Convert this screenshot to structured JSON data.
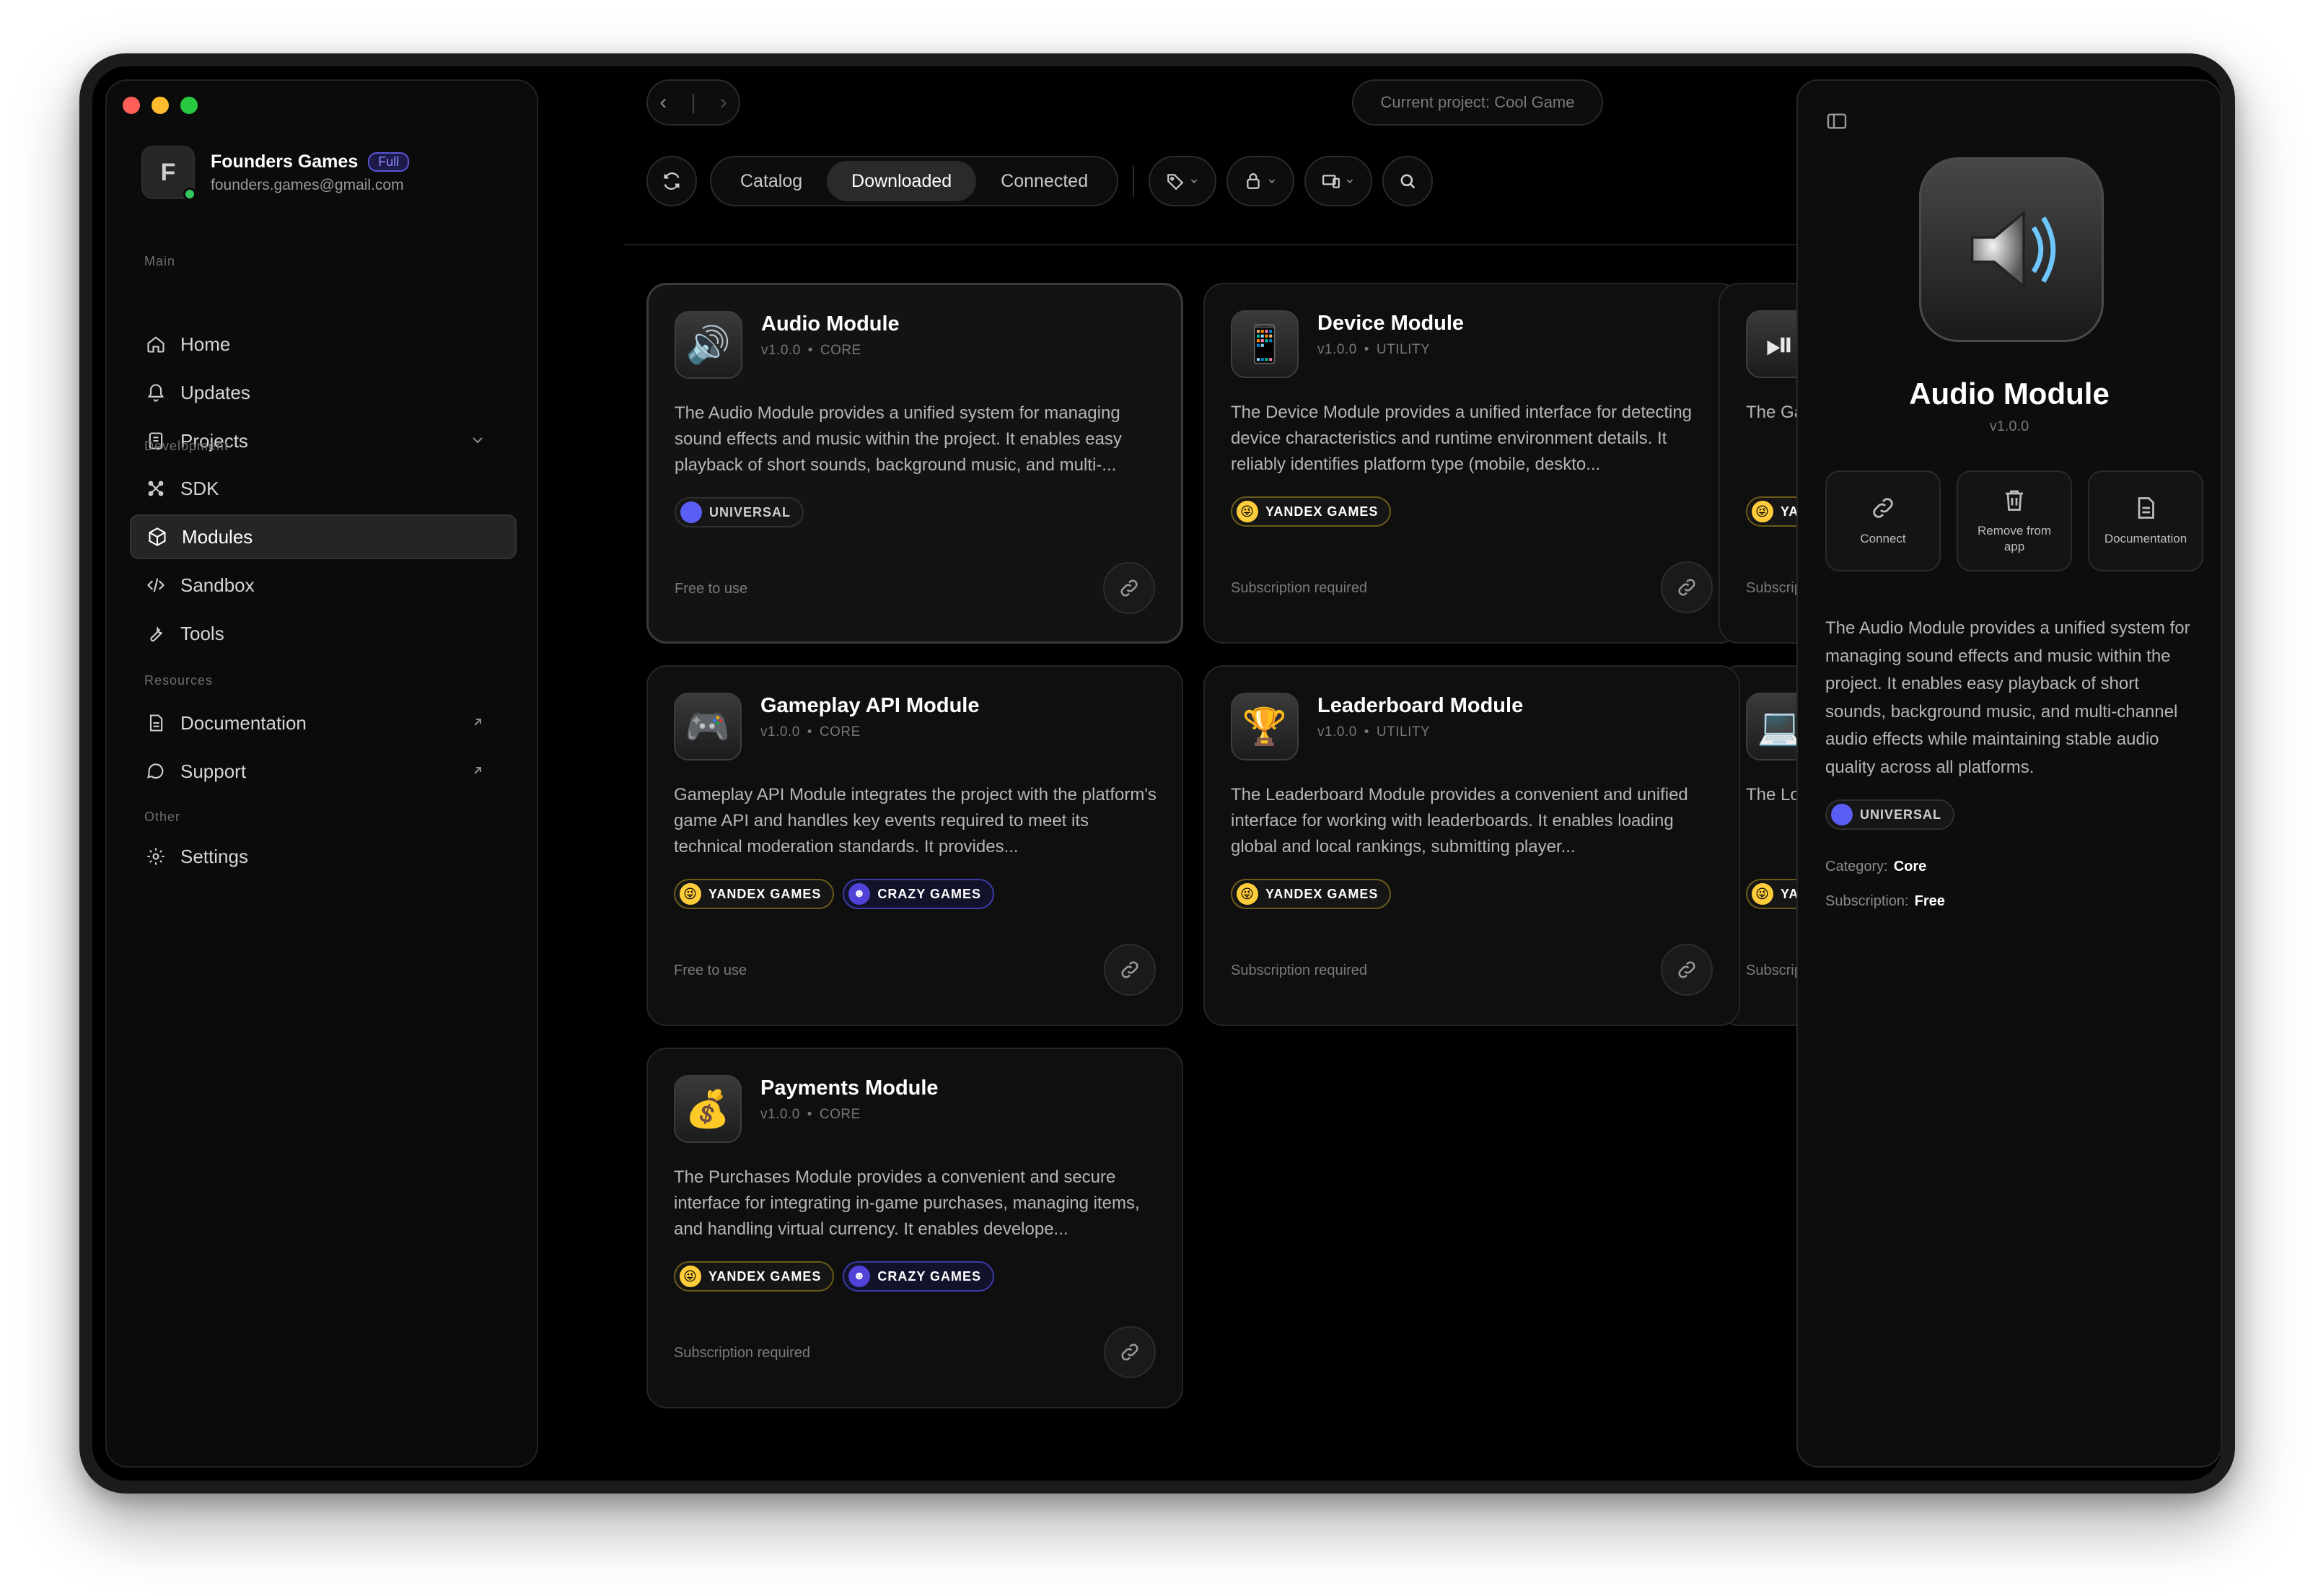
{
  "account": {
    "initial": "F",
    "name": "Founders Games",
    "plan": "Full",
    "email": "founders.games@gmail.com"
  },
  "sidebar": {
    "sections": {
      "main": "Main",
      "development": "Development",
      "resources": "Resources",
      "other": "Other"
    },
    "items": {
      "home": "Home",
      "updates": "Updates",
      "projects": "Projects",
      "sdk": "SDK",
      "modules": "Modules",
      "sandbox": "Sandbox",
      "tools": "Tools",
      "documentation": "Documentation",
      "support": "Support",
      "settings": "Settings"
    },
    "active": "modules"
  },
  "topbar": {
    "back": "‹",
    "forward": "›",
    "current_project": "Current project: Cool Game"
  },
  "tabs": [
    "Catalog",
    "Downloaded",
    "Connected"
  ],
  "active_tab": "Downloaded",
  "cards": [
    {
      "title": "Audio Module",
      "version": "v1.0.0",
      "category": "CORE",
      "icon": "speaker-icon",
      "description": "The Audio Module provides a unified system for managing sound effects and music within the project. It enables easy playback of short sounds, background music, and multi-...",
      "badges": [
        {
          "type": "universal",
          "label": "UNIVERSAL"
        }
      ],
      "footer": "Free to use"
    },
    {
      "title": "Device Module",
      "version": "v1.0.0",
      "category": "UTILITY",
      "icon": "phone-icon",
      "description": "The Device Module provides a unified interface for detecting device characteristics and runtime environment details. It reliably identifies platform type (mobile, deskto...",
      "badges": [
        {
          "type": "yandex",
          "label": "YANDEX GAMES"
        }
      ],
      "footer": "Subscription required"
    },
    {
      "title": "",
      "version": "",
      "category": "",
      "icon": "play-pause-icon",
      "description": "The Game... events trig... listens for...",
      "badges": [
        {
          "type": "yandex",
          "label": "YANDE"
        }
      ],
      "footer": "Subscription"
    },
    {
      "title": "Gameplay API Module",
      "version": "v1.0.0",
      "category": "CORE",
      "icon": "gamepad-icon",
      "description": "Gameplay API Module integrates the project with the platform's game API and handles key events required to meet its technical moderation standards. It provides...",
      "badges": [
        {
          "type": "yandex",
          "label": "YANDEX GAMES"
        },
        {
          "type": "crazy",
          "label": "CRAZY GAMES"
        }
      ],
      "footer": "Free to use"
    },
    {
      "title": "Leaderboard Module",
      "version": "v1.0.0",
      "category": "UTILITY",
      "icon": "trophy-icon",
      "description": "The Leaderboard Module provides a convenient and unified interface for working with leaderboards. It enables loading global and local rankings, submitting player...",
      "badges": [
        {
          "type": "yandex",
          "label": "YANDEX GAMES"
        }
      ],
      "footer": "Subscription required"
    },
    {
      "title": "",
      "version": "",
      "category": "",
      "icon": "laptop-icon",
      "description": "The Local... server tha... test integr...",
      "badges": [
        {
          "type": "yandex",
          "label": "YANDE"
        }
      ],
      "footer": "Subscription"
    },
    {
      "title": "Payments Module",
      "version": "v1.0.0",
      "category": "CORE",
      "icon": "money-bag-icon",
      "description": "The Purchases Module provides a convenient and secure interface for integrating in-game purchases, managing items, and handling virtual currency. It enables develope...",
      "badges": [
        {
          "type": "yandex",
          "label": "YANDEX GAMES"
        },
        {
          "type": "crazy",
          "label": "CRAZY GAMES"
        }
      ],
      "footer": "Subscription required"
    }
  ],
  "detail": {
    "title": "Audio Module",
    "version": "v1.0.0",
    "actions": {
      "connect": "Connect",
      "remove": "Remove from app",
      "documentation": "Documentation"
    },
    "description": "The Audio Module provides a unified system for managing sound effects and music within the project. It enables easy playback of short sounds, background music, and multi-channel audio effects while maintaining stable audio quality across all platforms.",
    "badge": "UNIVERSAL",
    "category_label": "Category:",
    "category": "Core",
    "subscription_label": "Subscription:",
    "subscription": "Free"
  },
  "colors": {
    "accent": "#5b5ef5",
    "yandex": "#ffcc3a",
    "crazy": "#5142d8",
    "online": "#34c759",
    "traffic_red": "#ff5f57",
    "traffic_yellow": "#febc2e",
    "traffic_green": "#28c840"
  }
}
